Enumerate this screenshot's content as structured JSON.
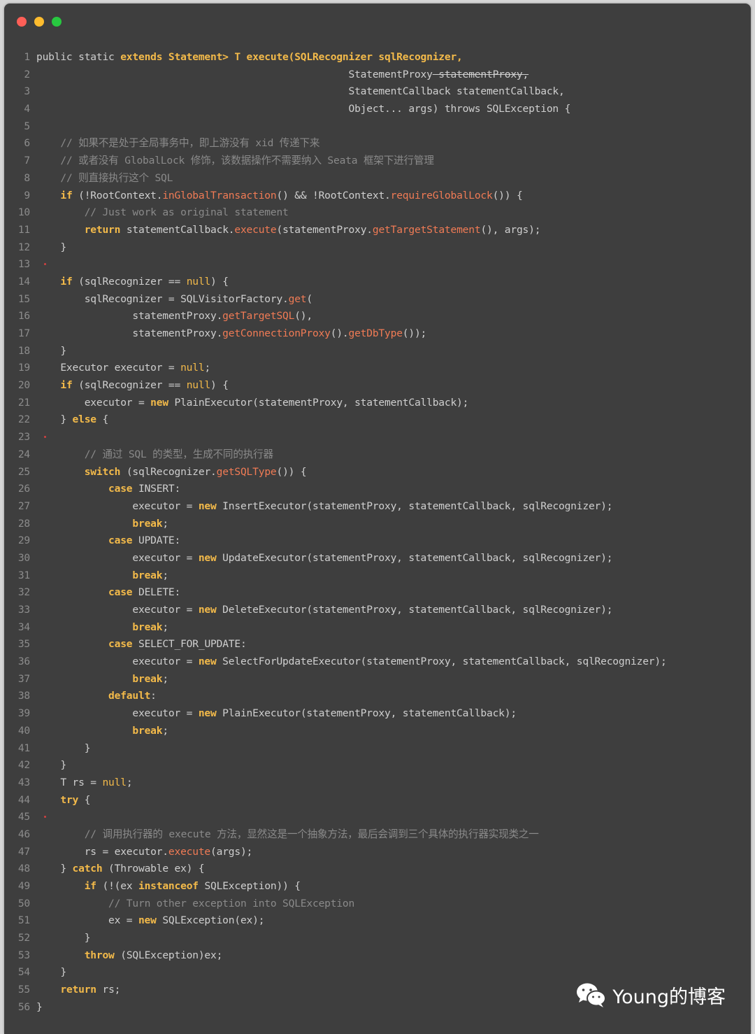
{
  "window": {
    "controls": [
      {
        "name": "close",
        "color": "#ff5f57"
      },
      {
        "name": "minimize",
        "color": "#febc2e"
      },
      {
        "name": "zoom",
        "color": "#28c840"
      }
    ]
  },
  "code": {
    "language": "java",
    "lines": [
      {
        "n": "1",
        "html": "public static <T, S <span class=\"kw\">extends</span> Statement> T execute(SQLRecognizer sqlRecognizer,"
      },
      {
        "n": "2",
        "html": "                                                    StatementProxy<S> statementProxy,"
      },
      {
        "n": "3",
        "html": "                                                    StatementCallback<T, S> statementCallback,"
      },
      {
        "n": "4",
        "html": "                                                    Object... args) throws SQLException {"
      },
      {
        "n": "5",
        "html": ""
      },
      {
        "n": "6",
        "html": "    <span class=\"cm\">// 如果不是处于全局事务中，即上游没有 xid 传递下来</span>"
      },
      {
        "n": "7",
        "html": "    <span class=\"cm\">// 或者没有 GlobalLock 修饰，该数据操作不需要纳入 Seata 框架下进行管理</span>"
      },
      {
        "n": "8",
        "html": "    <span class=\"cm\">// 则直接执行这个 SQL</span>"
      },
      {
        "n": "9",
        "html": "    <span class=\"kw\">if</span> (!RootContext.<span class=\"fn\">inGlobalTransaction</span>() && !RootContext.<span class=\"fn\">requireGlobalLock</span>()) {"
      },
      {
        "n": "10",
        "html": "        <span class=\"cm\">// Just work as original statement</span>"
      },
      {
        "n": "11",
        "html": "        <span class=\"kw\">return</span> statementCallback.<span class=\"fn\">execute</span>(statementProxy.<span class=\"fn\">getTargetStatement</span>(), args);"
      },
      {
        "n": "12",
        "html": "    }"
      },
      {
        "n": "13",
        "html": "",
        "marker": true
      },
      {
        "n": "14",
        "html": "    <span class=\"kw\">if</span> (sqlRecognizer == <span class=\"lit\">null</span>) {"
      },
      {
        "n": "15",
        "html": "        sqlRecognizer = SQLVisitorFactory.<span class=\"fn\">get</span>("
      },
      {
        "n": "16",
        "html": "                statementProxy.<span class=\"fn\">getTargetSQL</span>(),"
      },
      {
        "n": "17",
        "html": "                statementProxy.<span class=\"fn\">getConnectionProxy</span>().<span class=\"fn\">getDbType</span>());"
      },
      {
        "n": "18",
        "html": "    }"
      },
      {
        "n": "19",
        "html": "    Executor<T> executor = <span class=\"lit\">null</span>;"
      },
      {
        "n": "20",
        "html": "    <span class=\"kw\">if</span> (sqlRecognizer == <span class=\"lit\">null</span>) {"
      },
      {
        "n": "21",
        "html": "        executor = <span class=\"kw\">new</span> PlainExecutor<T, S>(statementProxy, statementCallback);"
      },
      {
        "n": "22",
        "html": "    } <span class=\"kw\">else</span> {"
      },
      {
        "n": "23",
        "html": "",
        "marker": true
      },
      {
        "n": "24",
        "html": "        <span class=\"cm\">// 通过 SQL 的类型，生成不同的执行器</span>"
      },
      {
        "n": "25",
        "html": "        <span class=\"kw\">switch</span> (sqlRecognizer.<span class=\"fn\">getSQLType</span>()) {"
      },
      {
        "n": "26",
        "html": "            <span class=\"kw\">case</span> INSERT:"
      },
      {
        "n": "27",
        "html": "                executor = <span class=\"kw\">new</span> InsertExecutor<T, S>(statementProxy, statementCallback, sqlRecognizer);"
      },
      {
        "n": "28",
        "html": "                <span class=\"kw\">break</span>;"
      },
      {
        "n": "29",
        "html": "            <span class=\"kw\">case</span> UPDATE:"
      },
      {
        "n": "30",
        "html": "                executor = <span class=\"kw\">new</span> UpdateExecutor<T, S>(statementProxy, statementCallback, sqlRecognizer);"
      },
      {
        "n": "31",
        "html": "                <span class=\"kw\">break</span>;"
      },
      {
        "n": "32",
        "html": "            <span class=\"kw\">case</span> DELETE:"
      },
      {
        "n": "33",
        "html": "                executor = <span class=\"kw\">new</span> DeleteExecutor<T, S>(statementProxy, statementCallback, sqlRecognizer);"
      },
      {
        "n": "34",
        "html": "                <span class=\"kw\">break</span>;"
      },
      {
        "n": "35",
        "html": "            <span class=\"kw\">case</span> SELECT_FOR_UPDATE:"
      },
      {
        "n": "36",
        "html": "                executor = <span class=\"kw\">new</span> SelectForUpdateExecutor<T, S>(statementProxy, statementCallback, sqlRecognizer);"
      },
      {
        "n": "37",
        "html": "                <span class=\"kw\">break</span>;"
      },
      {
        "n": "38",
        "html": "            <span class=\"kw\">default</span>:"
      },
      {
        "n": "39",
        "html": "                executor = <span class=\"kw\">new</span> PlainExecutor<T, S>(statementProxy, statementCallback);"
      },
      {
        "n": "40",
        "html": "                <span class=\"kw\">break</span>;"
      },
      {
        "n": "41",
        "html": "        }"
      },
      {
        "n": "42",
        "html": "    }"
      },
      {
        "n": "43",
        "html": "    T rs = <span class=\"lit\">null</span>;"
      },
      {
        "n": "44",
        "html": "    <span class=\"kw\">try</span> {"
      },
      {
        "n": "45",
        "html": "",
        "marker": true
      },
      {
        "n": "46",
        "html": "        <span class=\"cm\">// 调用执行器的 execute 方法，显然这是一个抽象方法，最后会调到三个具体的执行器实现类之一</span>"
      },
      {
        "n": "47",
        "html": "        rs = executor.<span class=\"fn\">execute</span>(args);"
      },
      {
        "n": "48",
        "html": "    } <span class=\"kw\">catch</span> (Throwable ex) {"
      },
      {
        "n": "49",
        "html": "        <span class=\"kw\">if</span> (!(ex <span class=\"kw\">instanceof</span> SQLException)) {"
      },
      {
        "n": "50",
        "html": "            <span class=\"cm\">// Turn other exception into SQLException</span>"
      },
      {
        "n": "51",
        "html": "            ex = <span class=\"kw\">new</span> SQLException(ex);"
      },
      {
        "n": "52",
        "html": "        }"
      },
      {
        "n": "53",
        "html": "        <span class=\"kw\">throw</span> (SQLException)ex;"
      },
      {
        "n": "54",
        "html": "    }"
      },
      {
        "n": "55",
        "html": "    <span class=\"kw\">return</span> rs;"
      },
      {
        "n": "56",
        "html": "}"
      }
    ]
  },
  "watermark": {
    "icon": "wechat-icon",
    "text": "Young的博客"
  }
}
